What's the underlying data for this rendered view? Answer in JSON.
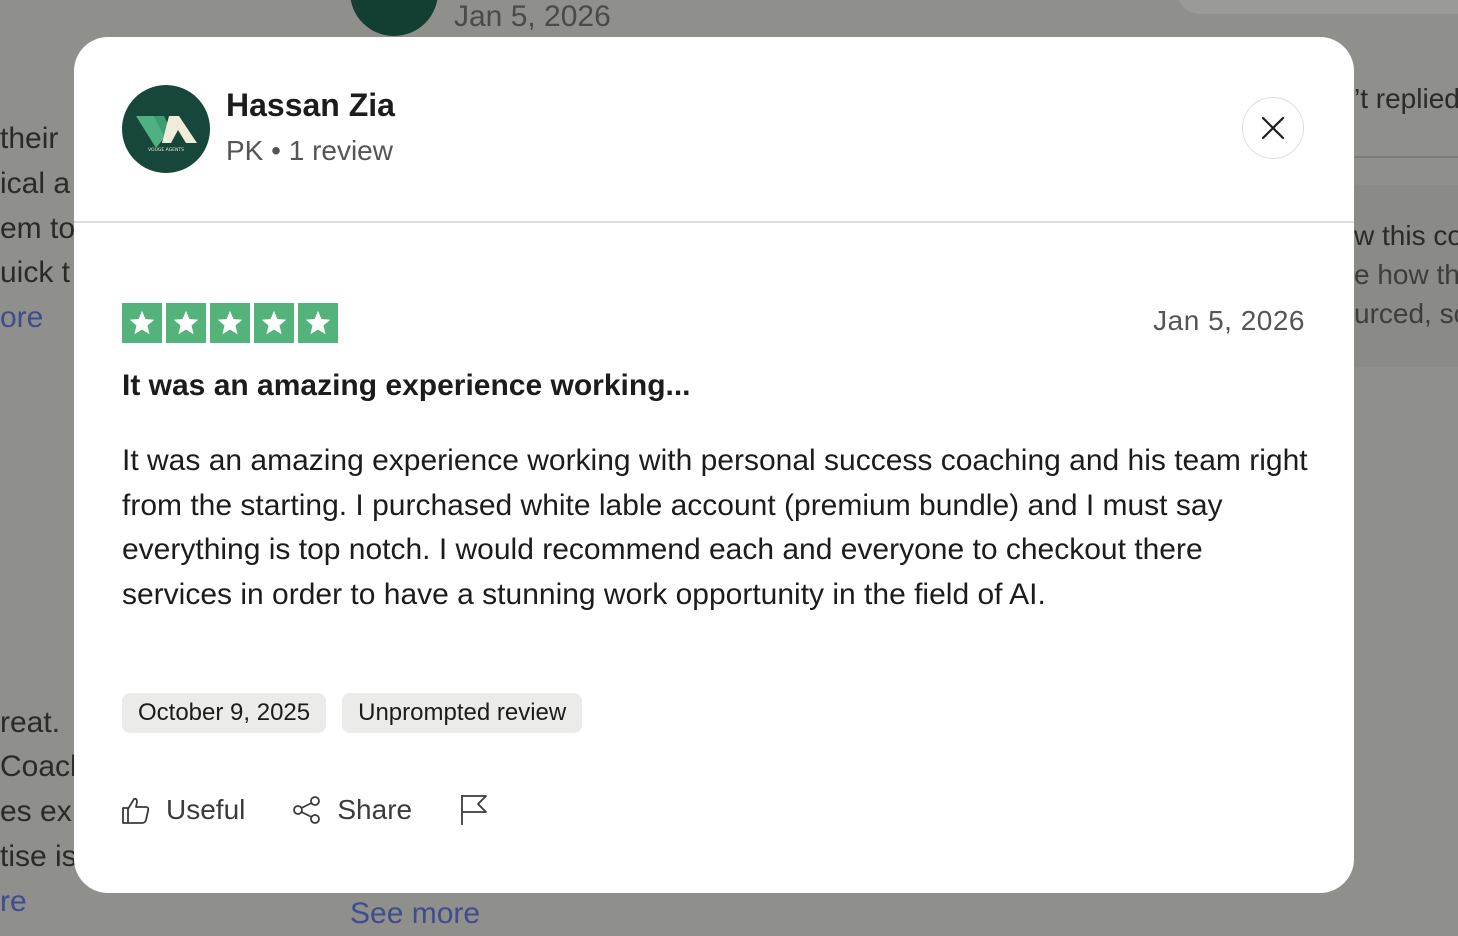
{
  "background": {
    "top_date": "Jan 5, 2026",
    "left_fragments": [
      "their",
      "ical a",
      "em to",
      "uick t",
      "ore",
      "reat.",
      "Coach",
      "es ex",
      "tise is",
      "re"
    ],
    "right_fragments": [
      "’t replied",
      "w this co",
      "e how th",
      "urced, so"
    ],
    "see_more": "See more"
  },
  "modal": {
    "user": {
      "name": "Hassan Zia",
      "meta": "PK • 1 review",
      "avatar_text": "VOUGE AGENTS"
    },
    "review": {
      "rating": 5,
      "date": "Jan 5, 2026",
      "title": "It was an amazing experience working...",
      "body": "It was an amazing experience working with personal success coaching and his team right from the starting. I purchased white lable account (premium bundle) and I must say everything is top notch. I would recommend each and everyone to checkout there services in order to have a stunning work opportunity in the field of AI.",
      "tags": [
        "October 9, 2025",
        "Unprompted review"
      ]
    },
    "actions": {
      "useful_label": "Useful",
      "share_label": "Share"
    },
    "icons": {
      "close": "close-icon",
      "useful": "thumbs-up-icon",
      "share": "share-icon",
      "flag": "flag-icon",
      "star": "star-icon"
    },
    "colors": {
      "star_green": "#54b37a",
      "avatar_bg": "#16473a",
      "link_blue": "#3f4d8f"
    }
  }
}
